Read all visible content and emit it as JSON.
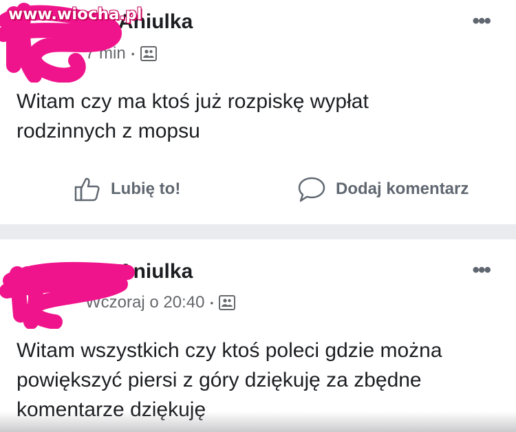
{
  "watermark": "www.wiocha.pl",
  "posts": [
    {
      "author": "a Aniulka",
      "time": "7 min",
      "text": "Witam czy ma ktoś już rozpiskę wypłat rodzinnych z mopsu",
      "like_label": "Lubię to!",
      "comment_label": "Dodaj komentarz"
    },
    {
      "author": "a Aniulka",
      "time": "Wczoraj o 20:40",
      "text": "Witam wszystkich czy ktoś poleci gdzie można powiększyć piersi z góry dziękuję za zbędne komentarze dziękuję"
    }
  ],
  "separator_dot": "•",
  "more_glyph": "•••",
  "colors": {
    "censor_pink": "#f0148c",
    "separator": "#e9ebee",
    "meta_gray": "#65676b"
  }
}
